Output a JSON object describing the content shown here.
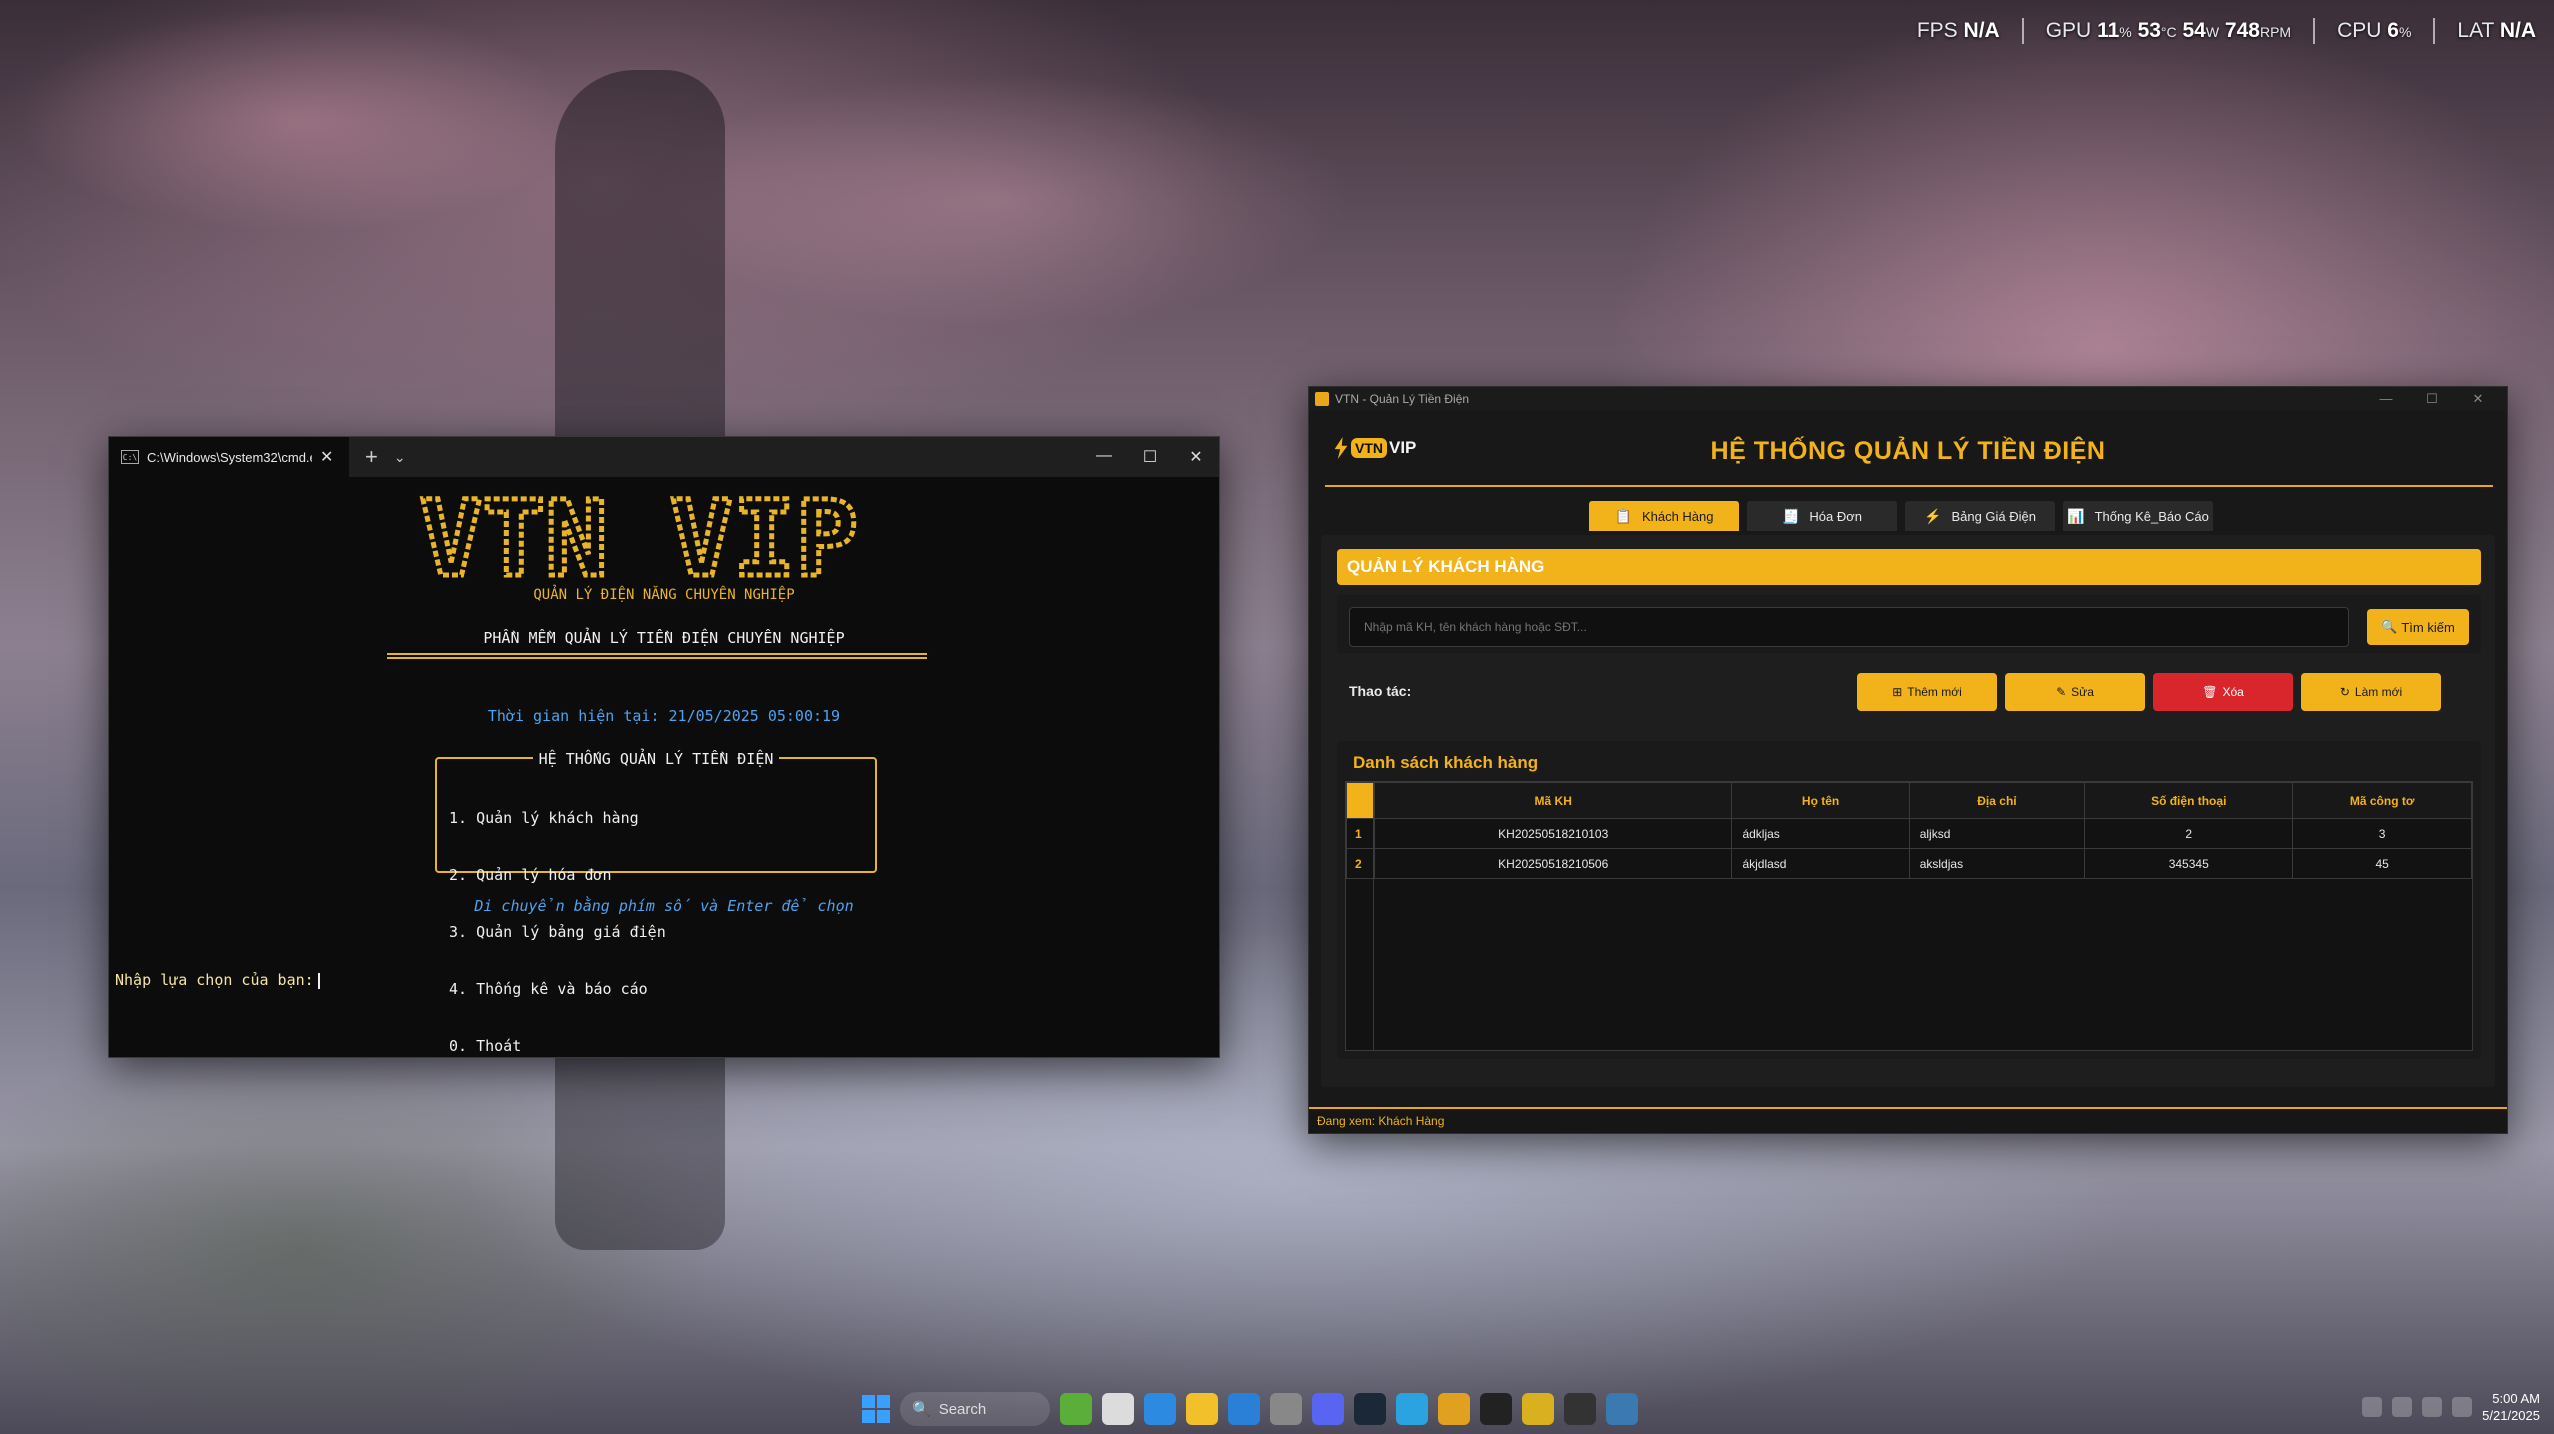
{
  "hud": {
    "fps_label": "FPS",
    "fps_value": "N/A",
    "gpu_label": "GPU",
    "gpu_util": "11",
    "gpu_util_unit": "%",
    "gpu_temp": "53",
    "gpu_temp_unit": "°C",
    "gpu_power": "54",
    "gpu_power_unit": "W",
    "gpu_fan": "748",
    "gpu_fan_unit": "RPM",
    "cpu_label": "CPU",
    "cpu_value": "6",
    "cpu_unit": "%",
    "lat_label": "LAT",
    "lat_value": "N/A"
  },
  "cmd": {
    "tab_title": "C:\\Windows\\System32\\cmd.e",
    "new_tab": "+",
    "dropdown": "⌄",
    "logo_text": "VTN VIP",
    "logo_subtitle": "QUẢN LÝ ĐIỆN NĂNG CHUYÊN NGHIỆP",
    "software_title": "PHẦN MỀM QUẢN LÝ TIỀN ĐIỆN CHUYÊN NGHIỆP",
    "time_line": "Thời gian hiện tại: 21/05/2025 05:00:19",
    "menu_title": "HỆ THỐNG QUẢN LÝ TIỀN ĐIỆN",
    "menu_items": [
      "1. Quản lý khách hàng",
      "2. Quản lý hóa đơn",
      "3. Quản lý bảng giá điện",
      "4. Thống kê và báo cáo",
      "0. Thoát"
    ],
    "hint": "Di chuyển bằng phím số và Enter để chọn",
    "prompt": "Nhập lựa chọn của bạn:"
  },
  "app": {
    "window_title": "VTN - Quản Lý Tiền Điện",
    "logo_vtn": "VTN",
    "logo_vip": "VIP",
    "heading": "HỆ THỐNG QUẢN LÝ TIỀN ĐIỆN",
    "tabs": [
      {
        "label": "Khách Hàng",
        "icon": "📋"
      },
      {
        "label": "Hóa Đơn",
        "icon": "🧾"
      },
      {
        "label": "Bảng Giá Điện",
        "icon": "⚡"
      },
      {
        "label": "Thống Kê_Báo Cáo",
        "icon": "📊"
      }
    ],
    "section_title": "QUẢN LÝ KHÁCH HÀNG",
    "search_placeholder": "Nhập mã KH, tên khách hàng hoặc SĐT...",
    "search_button": "Tìm kiếm",
    "actions_label": "Thao tác:",
    "buttons": {
      "add": "Thêm mới",
      "edit": "Sửa",
      "delete": "Xóa",
      "refresh": "Làm mới"
    },
    "list_title": "Danh sách khách hàng",
    "columns": [
      "Mã KH",
      "Họ tên",
      "Địa chỉ",
      "Số điện thoại",
      "Mã công tơ"
    ],
    "rows": [
      {
        "no": "1",
        "ma_kh": "KH20250518210103",
        "ho_ten": "ádkljas",
        "dia_chi": "aljksd",
        "sdt": "2",
        "ma_cong_to": "3"
      },
      {
        "no": "2",
        "ma_kh": "KH20250518210506",
        "ho_ten": "ákjdlasd",
        "dia_chi": "aksldjas",
        "sdt": "345345",
        "ma_cong_to": "45"
      }
    ],
    "status": "Đang xem: Khách Hàng"
  },
  "taskbar": {
    "search_label": "Search",
    "time": "5:00 AM",
    "date": "5/21/2025"
  }
}
